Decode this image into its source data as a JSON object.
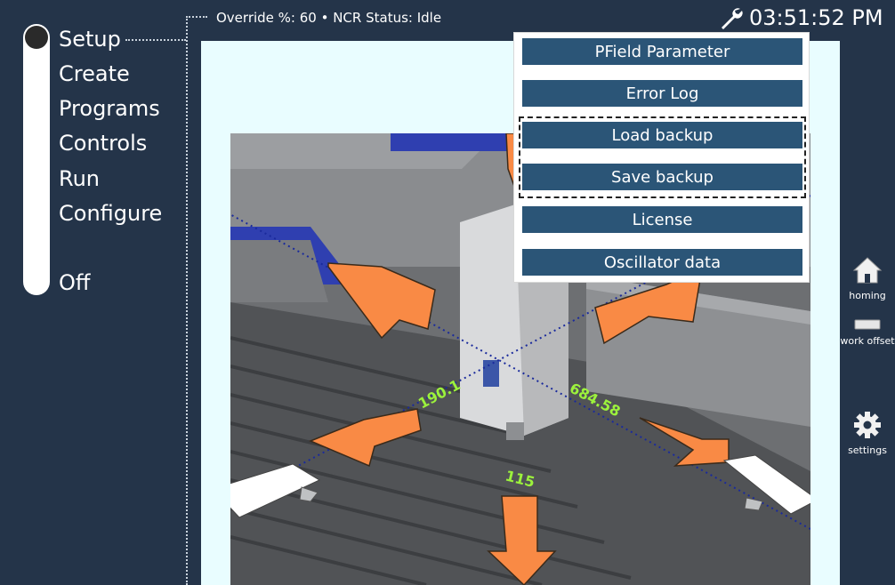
{
  "nav": {
    "items": [
      "Setup",
      "Create",
      "Programs",
      "Controls",
      "Run",
      "Configure"
    ],
    "off_label": "Off"
  },
  "header": {
    "status": "Override %: 60  •  NCR Status: Idle",
    "time": "03:51:52 PM"
  },
  "menu": {
    "items": [
      "PField Parameter",
      "Error Log",
      "Load backup",
      "Save backup",
      "License",
      "Oscillator data"
    ]
  },
  "viewport": {
    "axis_labels": [
      "190.1",
      "684.58",
      "115"
    ]
  },
  "tools": {
    "homing": "homing",
    "work_offset": "work offset",
    "settings": "settings"
  },
  "colors": {
    "background": "#243449",
    "menu_button": "#2b5577",
    "axis_label": "#9cf23c",
    "arrow": "#f98a45"
  }
}
